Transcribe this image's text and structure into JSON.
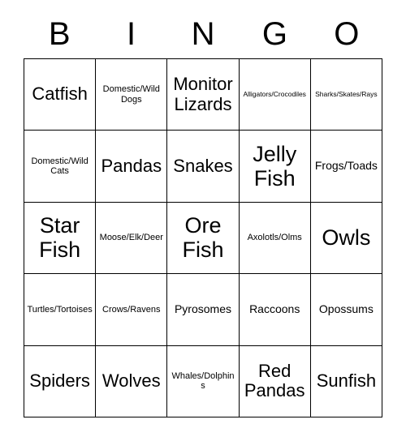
{
  "card": {
    "title": "BINGO",
    "header_letters": [
      "B",
      "I",
      "N",
      "G",
      "O"
    ],
    "columns": 5,
    "rows": 5,
    "border_color": "#000000",
    "background_color": "#ffffff",
    "text_color": "#000000",
    "cells": [
      [
        {
          "label": "Catfish",
          "size": "lg"
        },
        {
          "label": "Domestic/Wild Dogs",
          "size": "sm"
        },
        {
          "label": "Monitor Lizards",
          "size": "lg"
        },
        {
          "label": "Alligators/Crocodiles",
          "size": "xs"
        },
        {
          "label": "Sharks/Skates/Rays",
          "size": "xs"
        }
      ],
      [
        {
          "label": "Domestic/Wild Cats",
          "size": "sm"
        },
        {
          "label": "Pandas",
          "size": "lg"
        },
        {
          "label": "Snakes",
          "size": "lg"
        },
        {
          "label": "Jelly Fish",
          "size": "xl"
        },
        {
          "label": "Frogs/Toads",
          "size": "md"
        }
      ],
      [
        {
          "label": "Star Fish",
          "size": "xl"
        },
        {
          "label": "Moose/Elk/Deer",
          "size": "sm"
        },
        {
          "label": "Ore Fish",
          "size": "xl"
        },
        {
          "label": "Axolotls/Olms",
          "size": "sm"
        },
        {
          "label": "Owls",
          "size": "xl"
        }
      ],
      [
        {
          "label": "Turtles/Tortoises",
          "size": "sm"
        },
        {
          "label": "Crows/Ravens",
          "size": "sm"
        },
        {
          "label": "Pyrosomes",
          "size": "md"
        },
        {
          "label": "Raccoons",
          "size": "md"
        },
        {
          "label": "Opossums",
          "size": "md"
        }
      ],
      [
        {
          "label": "Spiders",
          "size": "lg"
        },
        {
          "label": "Wolves",
          "size": "lg"
        },
        {
          "label": "Whales/Dolphins",
          "size": "sm"
        },
        {
          "label": "Red Pandas",
          "size": "lg"
        },
        {
          "label": "Sunfish",
          "size": "lg"
        }
      ]
    ]
  }
}
